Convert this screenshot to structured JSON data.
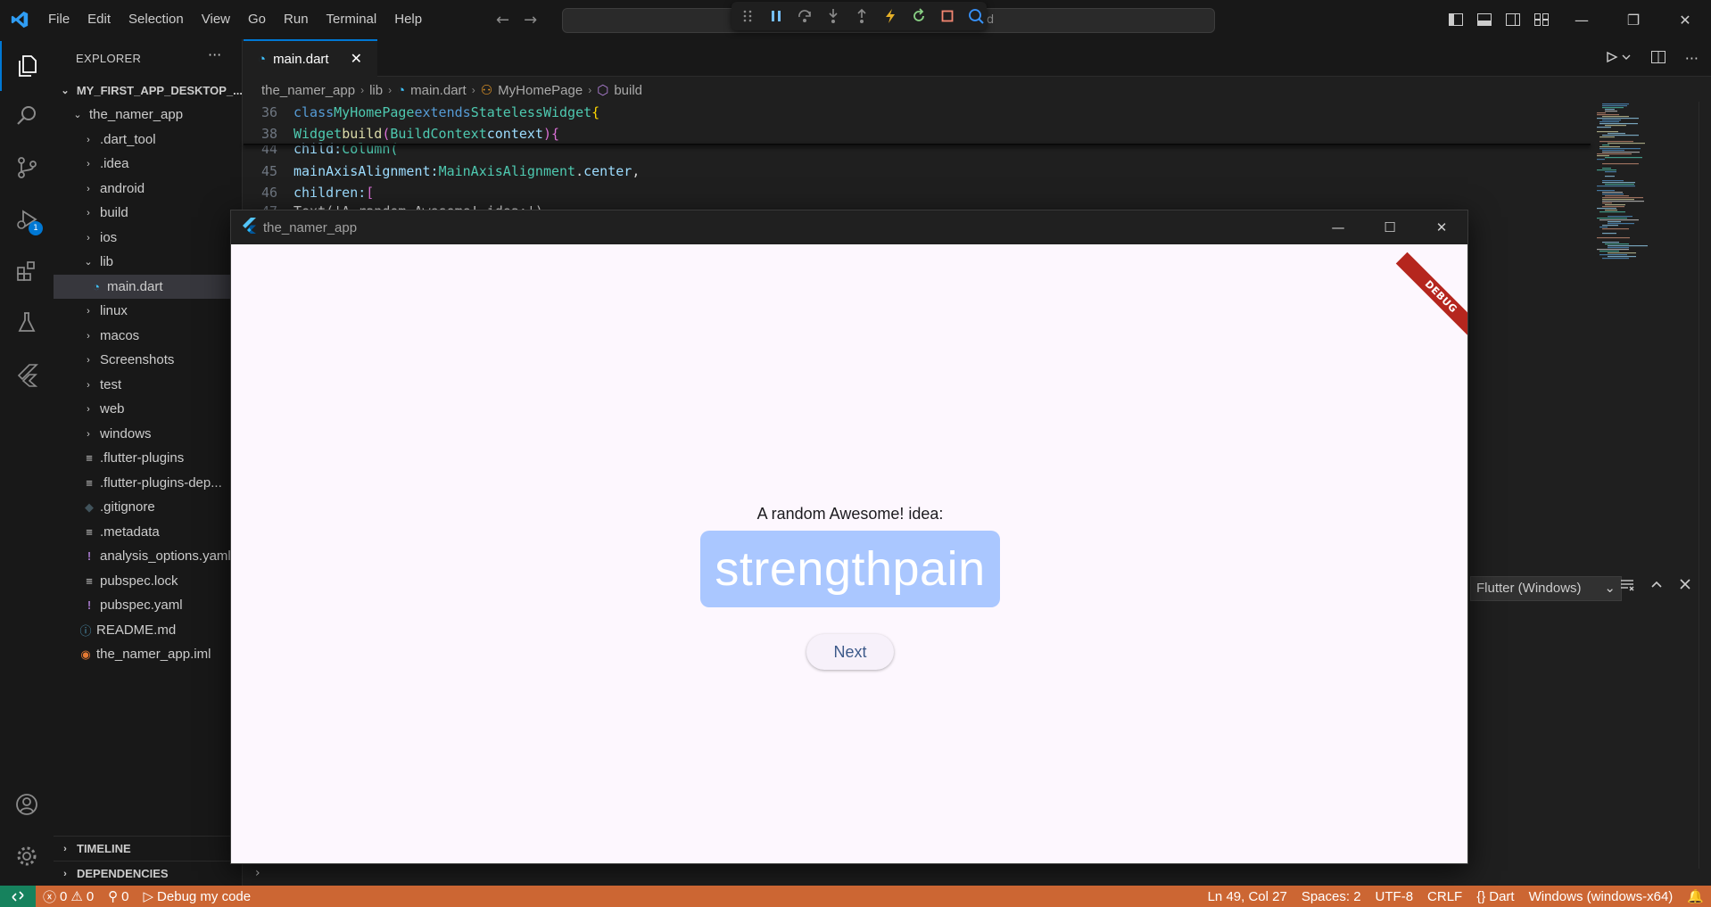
{
  "menu": [
    "File",
    "Edit",
    "Selection",
    "View",
    "Go",
    "Run",
    "Terminal",
    "Help"
  ],
  "command_center": {
    "text": "d"
  },
  "activity": {
    "debug_badge": "1"
  },
  "sidebar": {
    "header": "EXPLORER",
    "root": "MY_FIRST_APP_DESKTOP_...",
    "project": "the_namer_app",
    "items": [
      {
        "label": ".dart_tool"
      },
      {
        "label": ".idea"
      },
      {
        "label": "android"
      },
      {
        "label": "build"
      },
      {
        "label": "ios"
      },
      {
        "label": "lib"
      },
      {
        "label": "main.dart"
      },
      {
        "label": "linux"
      },
      {
        "label": "macos"
      },
      {
        "label": "Screenshots"
      },
      {
        "label": "test"
      },
      {
        "label": "web"
      },
      {
        "label": "windows"
      },
      {
        "label": ".flutter-plugins"
      },
      {
        "label": ".flutter-plugins-dep..."
      },
      {
        "label": ".gitignore"
      },
      {
        "label": ".metadata"
      },
      {
        "label": "analysis_options.yaml"
      },
      {
        "label": "pubspec.lock"
      },
      {
        "label": "pubspec.yaml"
      },
      {
        "label": "README.md"
      },
      {
        "label": "the_namer_app.iml"
      }
    ],
    "sections": [
      "TIMELINE",
      "DEPENDENCIES"
    ]
  },
  "editor": {
    "tab": "main.dart",
    "breadcrumbs": [
      "the_namer_app",
      "lib",
      "main.dart",
      "MyHomePage",
      "build"
    ],
    "lines": [
      {
        "n": "36",
        "parts": [
          "class",
          "MyHomePage",
          "extends",
          "StatelessWidget",
          "{"
        ]
      },
      {
        "n": "38",
        "parts": [
          "Widget",
          "build",
          "(",
          "BuildContext",
          "context",
          ")",
          "{"
        ]
      },
      {
        "n": "44",
        "parts": [
          "child:",
          "Column("
        ]
      },
      {
        "n": "45",
        "parts": [
          "mainAxisAlignment:",
          "MainAxisAlignment",
          ".",
          "center",
          ","
        ]
      },
      {
        "n": "46",
        "parts": [
          "children:",
          "["
        ]
      },
      {
        "n": "47",
        "parts": [
          "Text('A random Awesome! idea:'),"
        ]
      }
    ]
  },
  "panel": {
    "select_value": "Flutter (Windows)"
  },
  "app": {
    "title": "the_namer_app",
    "debug_banner": "DEBUG",
    "label": "A random Awesome! idea:",
    "word": "strengthpain",
    "next_button": "Next"
  },
  "status": {
    "errors": "0",
    "warnings": "0",
    "ports": "0",
    "debug": "Debug my code",
    "position": "Ln 49, Col 27",
    "spaces": "Spaces: 2",
    "encoding": "UTF-8",
    "eol": "CRLF",
    "language": "Dart",
    "device": "Windows (windows-x64)"
  },
  "colors": {
    "accent": "#0078d4",
    "statusbar": "#cc6633",
    "app_bg": "#fdf7fe",
    "word_card": "#aac7ff",
    "debug_banner": "#b5261e"
  }
}
